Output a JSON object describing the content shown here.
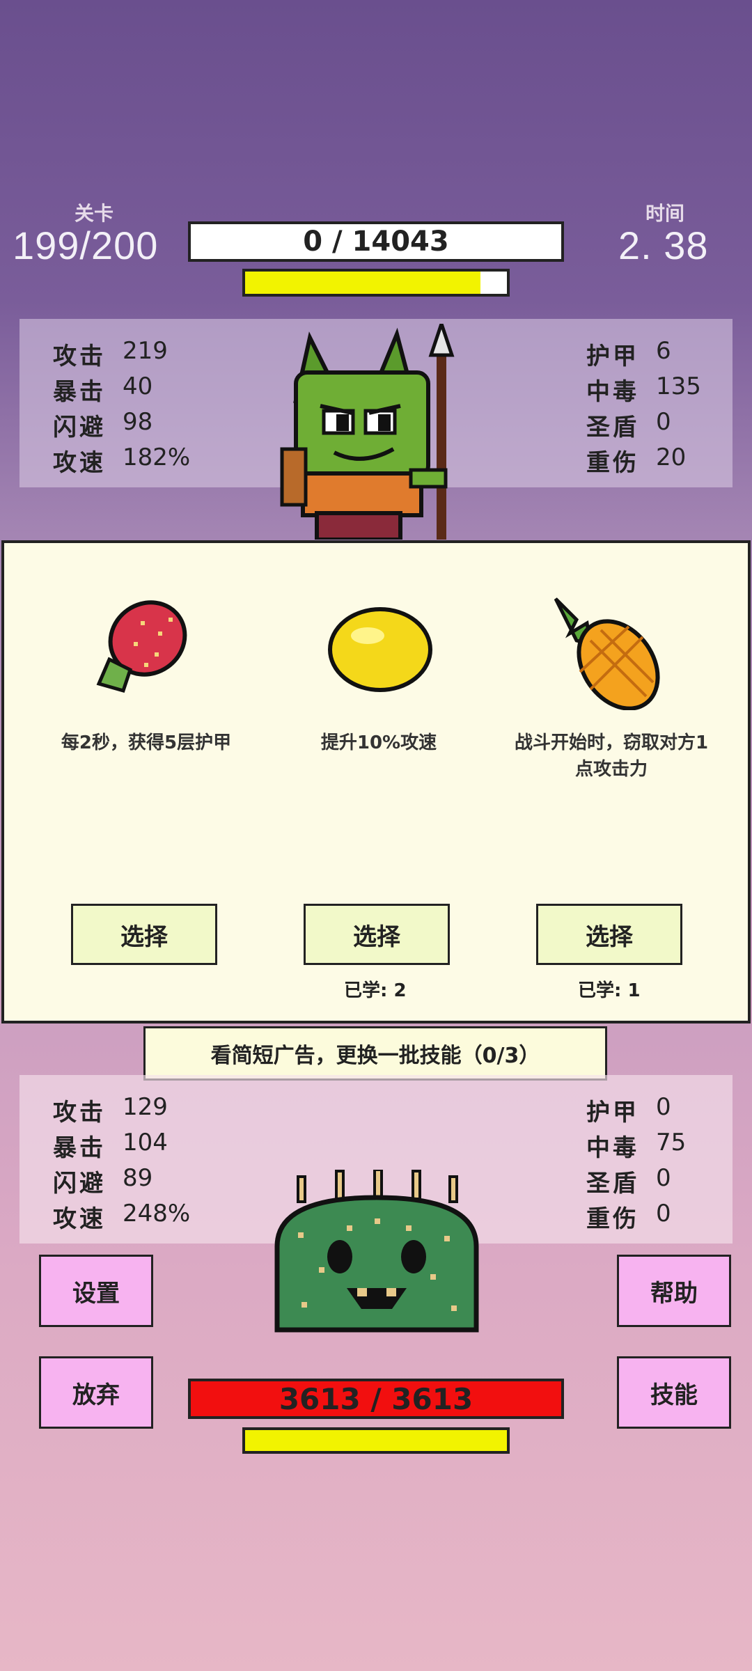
{
  "top": {
    "level_label": "关卡",
    "level_value": "199/200",
    "time_label": "时间",
    "time_value": "2. 38",
    "boss_hp_text": "0  /  14043",
    "boss_energy_fill_pct": 90
  },
  "enemy_stats": {
    "left": [
      {
        "k": "攻击",
        "v": "219"
      },
      {
        "k": "暴击",
        "v": "40"
      },
      {
        "k": "闪避",
        "v": "98"
      },
      {
        "k": "攻速",
        "v": "182%"
      }
    ],
    "right": [
      {
        "k": "护甲",
        "v": "6"
      },
      {
        "k": "中毒",
        "v": "135"
      },
      {
        "k": "圣盾",
        "v": "0"
      },
      {
        "k": "重伤",
        "v": "20"
      }
    ]
  },
  "choices": [
    {
      "icon": "strawberry-icon",
      "desc": "每2秒，获得5层护甲",
      "button": "选择",
      "learned": ""
    },
    {
      "icon": "lemon-icon",
      "desc": "提升10%攻速",
      "button": "选择",
      "learned": "已学: 2"
    },
    {
      "icon": "pineapple-icon",
      "desc": "战斗开始时，窃取对方1点攻击力",
      "button": "选择",
      "learned": "已学: 1"
    }
  ],
  "ad_refresh": "看简短广告，更换一批技能（0/3）",
  "player_stats": {
    "left": [
      {
        "k": "攻击",
        "v": "129"
      },
      {
        "k": "暴击",
        "v": "104"
      },
      {
        "k": "闪避",
        "v": "89"
      },
      {
        "k": "攻速",
        "v": "248%"
      }
    ],
    "right": [
      {
        "k": "护甲",
        "v": "0"
      },
      {
        "k": "中毒",
        "v": "75"
      },
      {
        "k": "圣盾",
        "v": "0"
      },
      {
        "k": "重伤",
        "v": "0"
      }
    ]
  },
  "buttons": {
    "settings": "设置",
    "help": "帮助",
    "give_up": "放弃",
    "skills": "技能"
  },
  "player": {
    "hp_text": "3613  /  3613",
    "energy_fill_pct": 100
  },
  "colors": {
    "hp_red": "#f20f0f",
    "energy_yellow": "#f2f300",
    "button_pink": "#f7b3f0",
    "choose_green": "#f2f9c9"
  }
}
